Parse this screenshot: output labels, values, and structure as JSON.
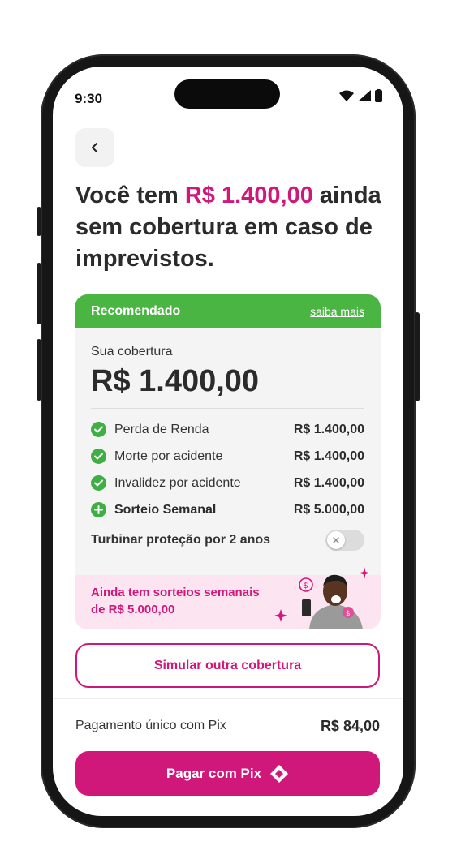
{
  "status_bar": {
    "time": "9:30",
    "icons": [
      "wifi-icon",
      "signal-icon",
      "battery-icon"
    ]
  },
  "nav": {
    "back_icon": "chevron-left-icon"
  },
  "headline": {
    "prefix": "Você tem ",
    "amount": "R$ 1.400,00",
    "suffix": " ainda sem cobertura em caso de imprevistos."
  },
  "card": {
    "header_label": "Recomendado",
    "header_link": "saiba mais",
    "coverage_label": "Sua cobertura",
    "coverage_value": "R$ 1.400,00",
    "items": [
      {
        "name": "Perda de Renda",
        "amount": "R$ 1.400,00",
        "icon": "check-icon"
      },
      {
        "name": "Morte por acidente",
        "amount": "R$ 1.400,00",
        "icon": "check-icon"
      },
      {
        "name": "Invalidez por acidente",
        "amount": "R$ 1.400,00",
        "icon": "check-icon"
      },
      {
        "name": "Sorteio Semanal",
        "amount": "R$ 5.000,00",
        "icon": "plus-icon"
      }
    ],
    "turbo_label": "Turbinar proteção por 2 anos",
    "turbo_enabled": false,
    "promo_text": "Ainda tem sorteios semanais de R$ 5.000,00"
  },
  "simulate_button": "Simular outra cobertura",
  "payment": {
    "label": "Pagamento único com Pix",
    "amount": "R$ 84,00"
  },
  "pay_button": {
    "label": "Pagar com Pix",
    "icon": "pix-icon"
  },
  "colors": {
    "accent": "#d0177a",
    "green": "#4bb543",
    "promo_bg": "#fde4f1"
  }
}
